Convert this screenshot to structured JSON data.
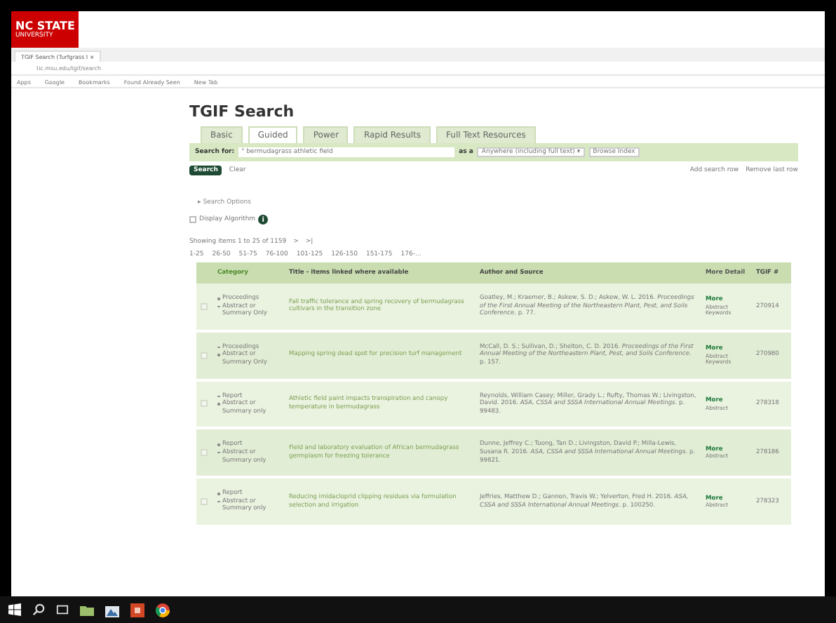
{
  "logo": {
    "line_1": "NC STATE",
    "line_2": "UNIVERSITY"
  },
  "browser": {
    "tab_title": "TGIF Search (Turfgrass I",
    "tab_close": "×",
    "address": "tic.msu.edu/tgif/search",
    "bookmarks": [
      "Apps",
      "Google",
      "Bookmarks",
      "Found Already Seen",
      "New Tab"
    ]
  },
  "page_title": "TGIF Search",
  "tabs": [
    {
      "label": "Basic",
      "selected": false
    },
    {
      "label": "Guided",
      "selected": true
    },
    {
      "label": "Power",
      "selected": false
    },
    {
      "label": "Rapid Results",
      "selected": false
    },
    {
      "label": "Full Text Resources",
      "selected": false
    }
  ],
  "search_row": {
    "label": "Search for:",
    "value": "\" bermudagrass athletic field",
    "as_label": "as a",
    "scope": "Anywhere (including full text) ▾",
    "browse": "Browse Index"
  },
  "actions": {
    "search": "Search",
    "clear": "Clear",
    "add_row": "Add search row",
    "remove_row": "Remove last row"
  },
  "search_options": "▸ Search Options",
  "display_algorithm": {
    "label": "Display Algorithm",
    "checked": false,
    "info": "i"
  },
  "showing": {
    "text": "Showing items 1 to 25 of 1159",
    "next": ">",
    "last": ">|"
  },
  "pages": [
    "1-25",
    "26-50",
    "51-75",
    "76-100",
    "101-125",
    "126-150",
    "151-175",
    "176-..."
  ],
  "table": {
    "columns": [
      "Category",
      "Title - items linked where available",
      "Author and Source",
      "More Detail",
      "TGIF #"
    ],
    "rows": [
      {
        "selected": false,
        "categories": [
          "Proceedings",
          "Abstract or Summary Only"
        ],
        "title": "Fall traffic tolerance and spring recovery of bermudagrass cultivars in the transition zone",
        "author": "Goatley, M.; Kraemer, B.; Askew, S. D.; Askew, W. L. 2016. *Proceedings of the First Annual Meeting of the Northeastern Plant, Pest, and Soils Conference*. p. 77.",
        "more": "More",
        "more_note": "Abstract Keywords",
        "tgif": "270914"
      },
      {
        "selected": false,
        "categories": [
          "Proceedings",
          "Abstract or Summary Only"
        ],
        "title": "Mapping spring dead spot for precision turf management",
        "author": "McCall, D. S.; Sullivan, D.; Shelton, C. D. 2016. *Proceedings of the First Annual Meeting of the Northeastern Plant, Pest, and Soils Conference*. p. 157.",
        "more": "More",
        "more_note": "Abstract Keywords",
        "tgif": "270980"
      },
      {
        "selected": false,
        "categories": [
          "Report",
          "Abstract or Summary only"
        ],
        "title": "Athletic field paint impacts transpiration and canopy temperature in bermudagrass",
        "author": "Reynolds, William Casey; Miller, Grady L.; Rufty, Thomas W.; Livingston, David. 2016. *ASA, CSSA and SSSA International Annual Meetings*. p. 99483.",
        "more": "More",
        "more_note": "Abstract",
        "tgif": "278318"
      },
      {
        "selected": false,
        "categories": [
          "Report",
          "Abstract or Summary only"
        ],
        "title": "Field and laboratory evaluation of African bermudagrass germplasm for freezing tolerance",
        "author": "Dunne, Jeffrey C.; Tuong, Tan D.; Livingston, David P.; Milla-Lewis, Susana R. 2016. *ASA, CSSA and SSSA International Annual Meetings*. p. 99821.",
        "more": "More",
        "more_note": "Abstract",
        "tgif": "278186"
      },
      {
        "selected": false,
        "categories": [
          "Report",
          "Abstract or Summary only"
        ],
        "title": "Reducing imidacloprid clipping residues via formulation selection and irrigation",
        "author": "Jeffries, Matthew D.; Gannon, Travis W.; Yelverton, Fred H. 2016. *ASA, CSSA and SSSA International Annual Meetings*. p. 100250.",
        "more": "More",
        "more_note": "Abstract",
        "tgif": "278323"
      }
    ]
  },
  "taskbar": [
    {
      "kind": "start"
    },
    {
      "kind": "search"
    },
    {
      "kind": "taskview"
    },
    {
      "kind": "folder"
    },
    {
      "kind": "store"
    },
    {
      "kind": "office"
    },
    {
      "kind": "chrome"
    }
  ]
}
